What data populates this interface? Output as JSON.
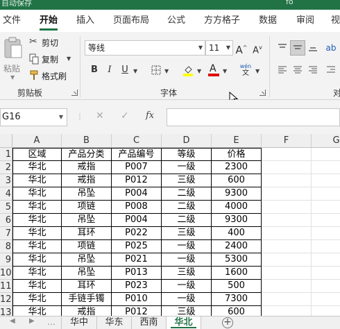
{
  "titlebar": {
    "left_text": "自动保存",
    "right_text": "fo"
  },
  "tabs": [
    {
      "label": "文件"
    },
    {
      "label": "开始"
    },
    {
      "label": "插入"
    },
    {
      "label": "页面布局"
    },
    {
      "label": "公式"
    },
    {
      "label": "方方格子"
    },
    {
      "label": "数据"
    },
    {
      "label": "审阅"
    },
    {
      "label": "视"
    }
  ],
  "ribbon": {
    "clipboard": {
      "paste": "粘贴",
      "cut": "剪切",
      "copy": "复制",
      "format_painter": "格式刷",
      "group": "剪贴板"
    },
    "font": {
      "name": "等线",
      "size": "11",
      "group": "字体",
      "pinyin": "wén",
      "pinyin_char": "文"
    },
    "alignment": {
      "group_partial": "对"
    }
  },
  "formula_bar": {
    "name_box": "G16",
    "fx": "fx",
    "formula": ""
  },
  "columns": [
    "A",
    "B",
    "C",
    "D",
    "E",
    "F",
    "G"
  ],
  "row_numbers": [
    "1",
    "2",
    "3",
    "4",
    "5",
    "6",
    "7",
    "8",
    "9",
    "10",
    "11",
    "12",
    "13"
  ],
  "table": {
    "header": [
      "区域",
      "产品分类",
      "产品编号",
      "等级",
      "价格"
    ],
    "rows": [
      [
        "华北",
        "戒指",
        "P007",
        "一级",
        "2300"
      ],
      [
        "华北",
        "戒指",
        "P012",
        "三级",
        "600"
      ],
      [
        "华北",
        "吊坠",
        "P004",
        "二级",
        "9300"
      ],
      [
        "华北",
        "项链",
        "P008",
        "二级",
        "4000"
      ],
      [
        "华北",
        "吊坠",
        "P004",
        "二级",
        "9300"
      ],
      [
        "华北",
        "耳环",
        "P022",
        "三级",
        "400"
      ],
      [
        "华北",
        "项链",
        "P025",
        "一级",
        "2400"
      ],
      [
        "华北",
        "吊坠",
        "P021",
        "一级",
        "5300"
      ],
      [
        "华北",
        "吊坠",
        "P013",
        "三级",
        "1600"
      ],
      [
        "华北",
        "耳环",
        "P023",
        "一级",
        "500"
      ],
      [
        "华北",
        "手链手镯",
        "P010",
        "一级",
        "7300"
      ],
      [
        "华北",
        "戒指",
        "P012",
        "三级",
        "600"
      ]
    ]
  },
  "sheets": [
    {
      "label": "华中"
    },
    {
      "label": "华东"
    },
    {
      "label": "西南"
    },
    {
      "label": "华北"
    }
  ],
  "colors": {
    "accent": "#217346"
  }
}
